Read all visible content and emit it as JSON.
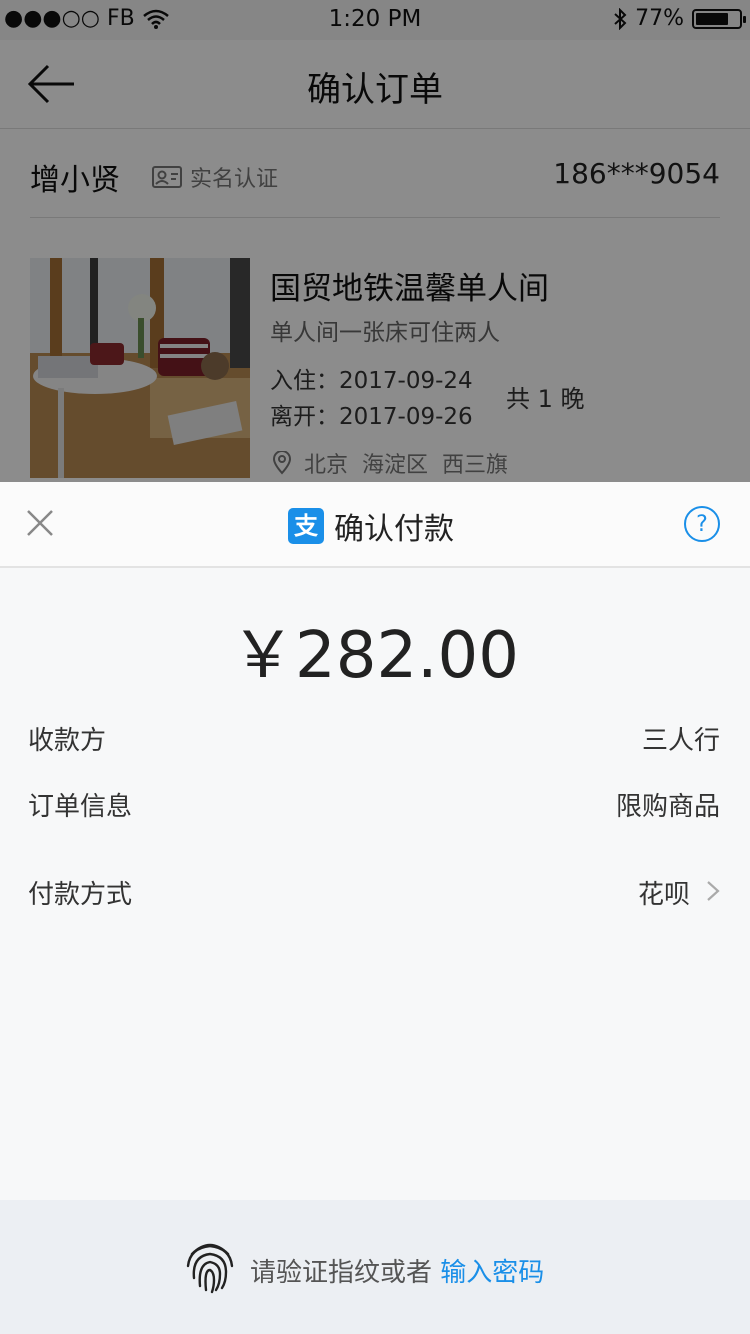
{
  "status_bar": {
    "carrier": "●●●○○ FB",
    "time": "1:20 PM",
    "battery": "77%",
    "battery_level": 0.77
  },
  "nav": {
    "title": "确认订单",
    "back_icon": "arrow-left-icon"
  },
  "user": {
    "name": "增小贤",
    "verify_label": "实名认证",
    "phone": "186***9054"
  },
  "room": {
    "title": "国贸地铁温馨单人间",
    "subtitle": "单人间一张床可住两人",
    "checkin": "入住：2017-09-24",
    "checkout": "离开：2017-09-26",
    "nights": "共 1 晚",
    "location": [
      "北京",
      "海淀区",
      "西三旗"
    ]
  },
  "payment": {
    "title": "确认付款",
    "amount": "￥282.00",
    "rows": [
      {
        "label": "收款方",
        "value": "三人行"
      },
      {
        "label": "订单信息",
        "value": "限购商品"
      },
      {
        "label": "付款方式",
        "value": "花呗"
      }
    ],
    "footer_text": "请验证指纹或者",
    "footer_link": "输入密码",
    "colors": {
      "accent": "#1a8fe8",
      "sheet": "#f7f8f9",
      "footer": "#eceff3"
    }
  }
}
